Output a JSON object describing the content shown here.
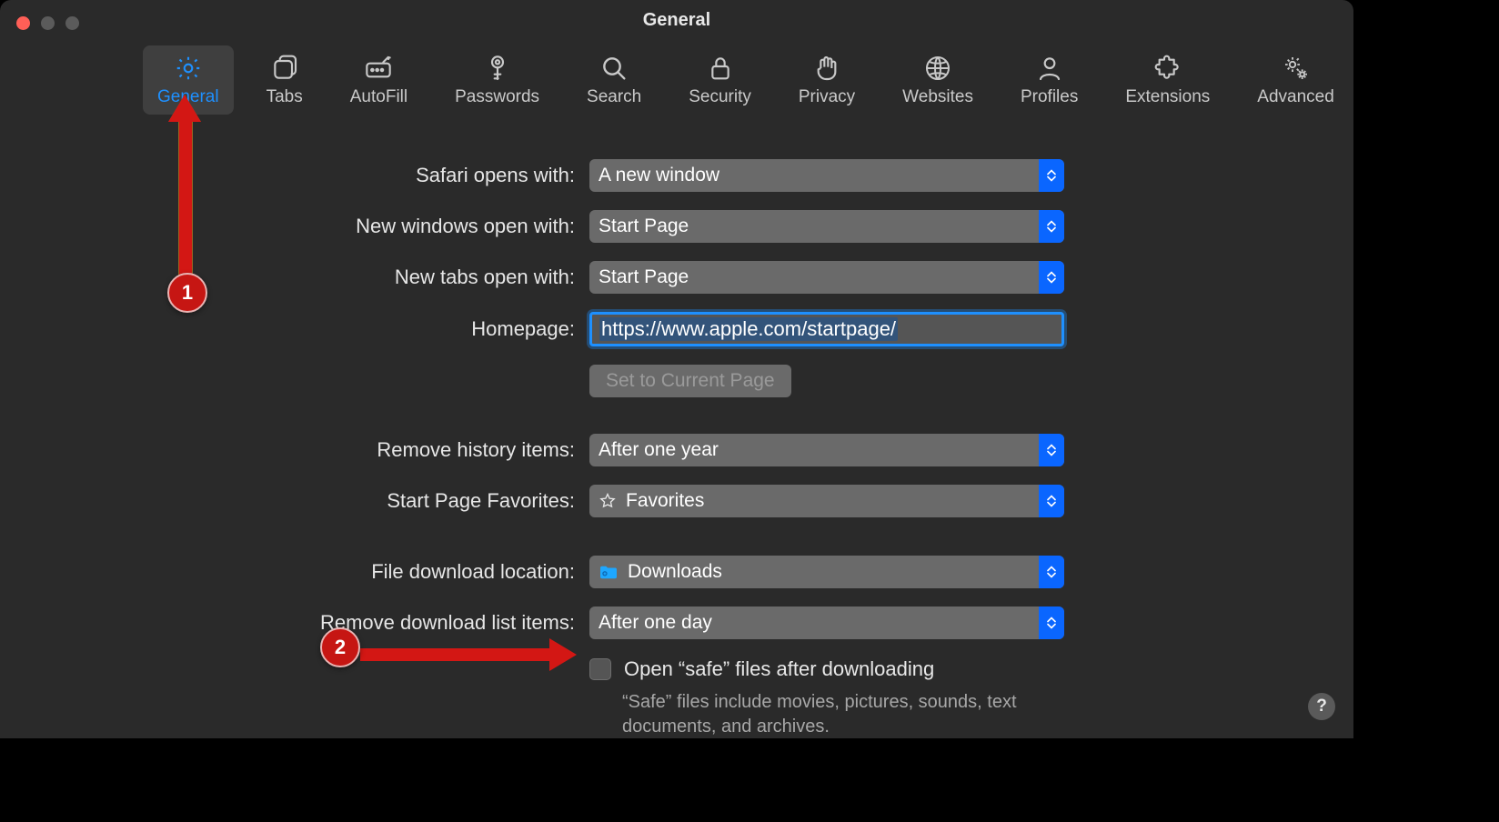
{
  "window": {
    "title": "General"
  },
  "toolbar": {
    "items": [
      {
        "label": "General",
        "icon": "gear-icon",
        "active": true
      },
      {
        "label": "Tabs",
        "icon": "tabs-icon"
      },
      {
        "label": "AutoFill",
        "icon": "autofill-icon"
      },
      {
        "label": "Passwords",
        "icon": "key-icon"
      },
      {
        "label": "Search",
        "icon": "search-icon"
      },
      {
        "label": "Security",
        "icon": "lock-icon"
      },
      {
        "label": "Privacy",
        "icon": "hand-icon"
      },
      {
        "label": "Websites",
        "icon": "globe-icon"
      },
      {
        "label": "Profiles",
        "icon": "profile-icon"
      },
      {
        "label": "Extensions",
        "icon": "puzzle-icon"
      },
      {
        "label": "Advanced",
        "icon": "gears-icon"
      }
    ]
  },
  "form": {
    "safari_opens_with": {
      "label": "Safari opens with:",
      "value": "A new window"
    },
    "new_windows_open_with": {
      "label": "New windows open with:",
      "value": "Start Page"
    },
    "new_tabs_open_with": {
      "label": "New tabs open with:",
      "value": "Start Page"
    },
    "homepage": {
      "label": "Homepage:",
      "value": "https://www.apple.com/startpage/"
    },
    "set_current_page": "Set to Current Page",
    "remove_history": {
      "label": "Remove history items:",
      "value": "After one year"
    },
    "start_page_favorites": {
      "label": "Start Page Favorites:",
      "value": "Favorites"
    },
    "download_location": {
      "label": "File download location:",
      "value": "Downloads"
    },
    "remove_downloads": {
      "label": "Remove download list items:",
      "value": "After one day"
    },
    "open_safe": {
      "label": "Open “safe” files after downloading",
      "hint": "“Safe” files include movies, pictures, sounds, text documents, and archives.",
      "checked": false
    }
  },
  "annotations": {
    "badge1": "1",
    "badge2": "2"
  },
  "help": "?"
}
